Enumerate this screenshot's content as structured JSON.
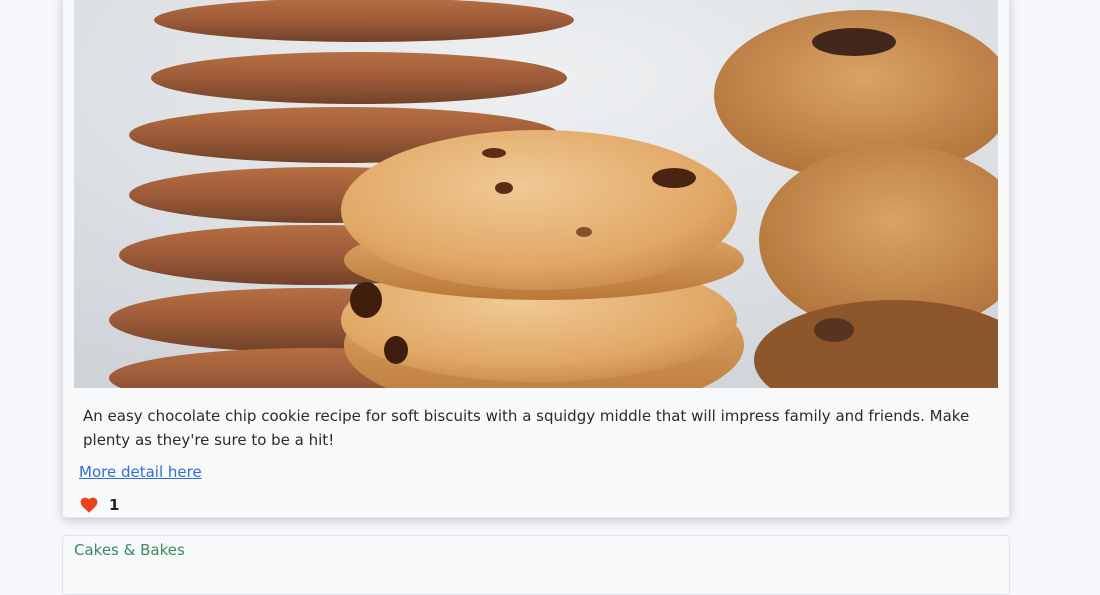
{
  "recipe_card": {
    "image_description": "stacked chocolate chip cookies",
    "description": "An easy chocolate chip cookie recipe for soft biscuits with a squidgy middle that will impress family and friends. Make plenty as they're sure to be a hit!",
    "detail_link_label": "More detail here",
    "like_icon": "heart-icon",
    "like_color": "#e8441a",
    "like_count": "1"
  },
  "next_card": {
    "category_label": "Cakes & Bakes",
    "category_color": "#3d8a5e"
  }
}
